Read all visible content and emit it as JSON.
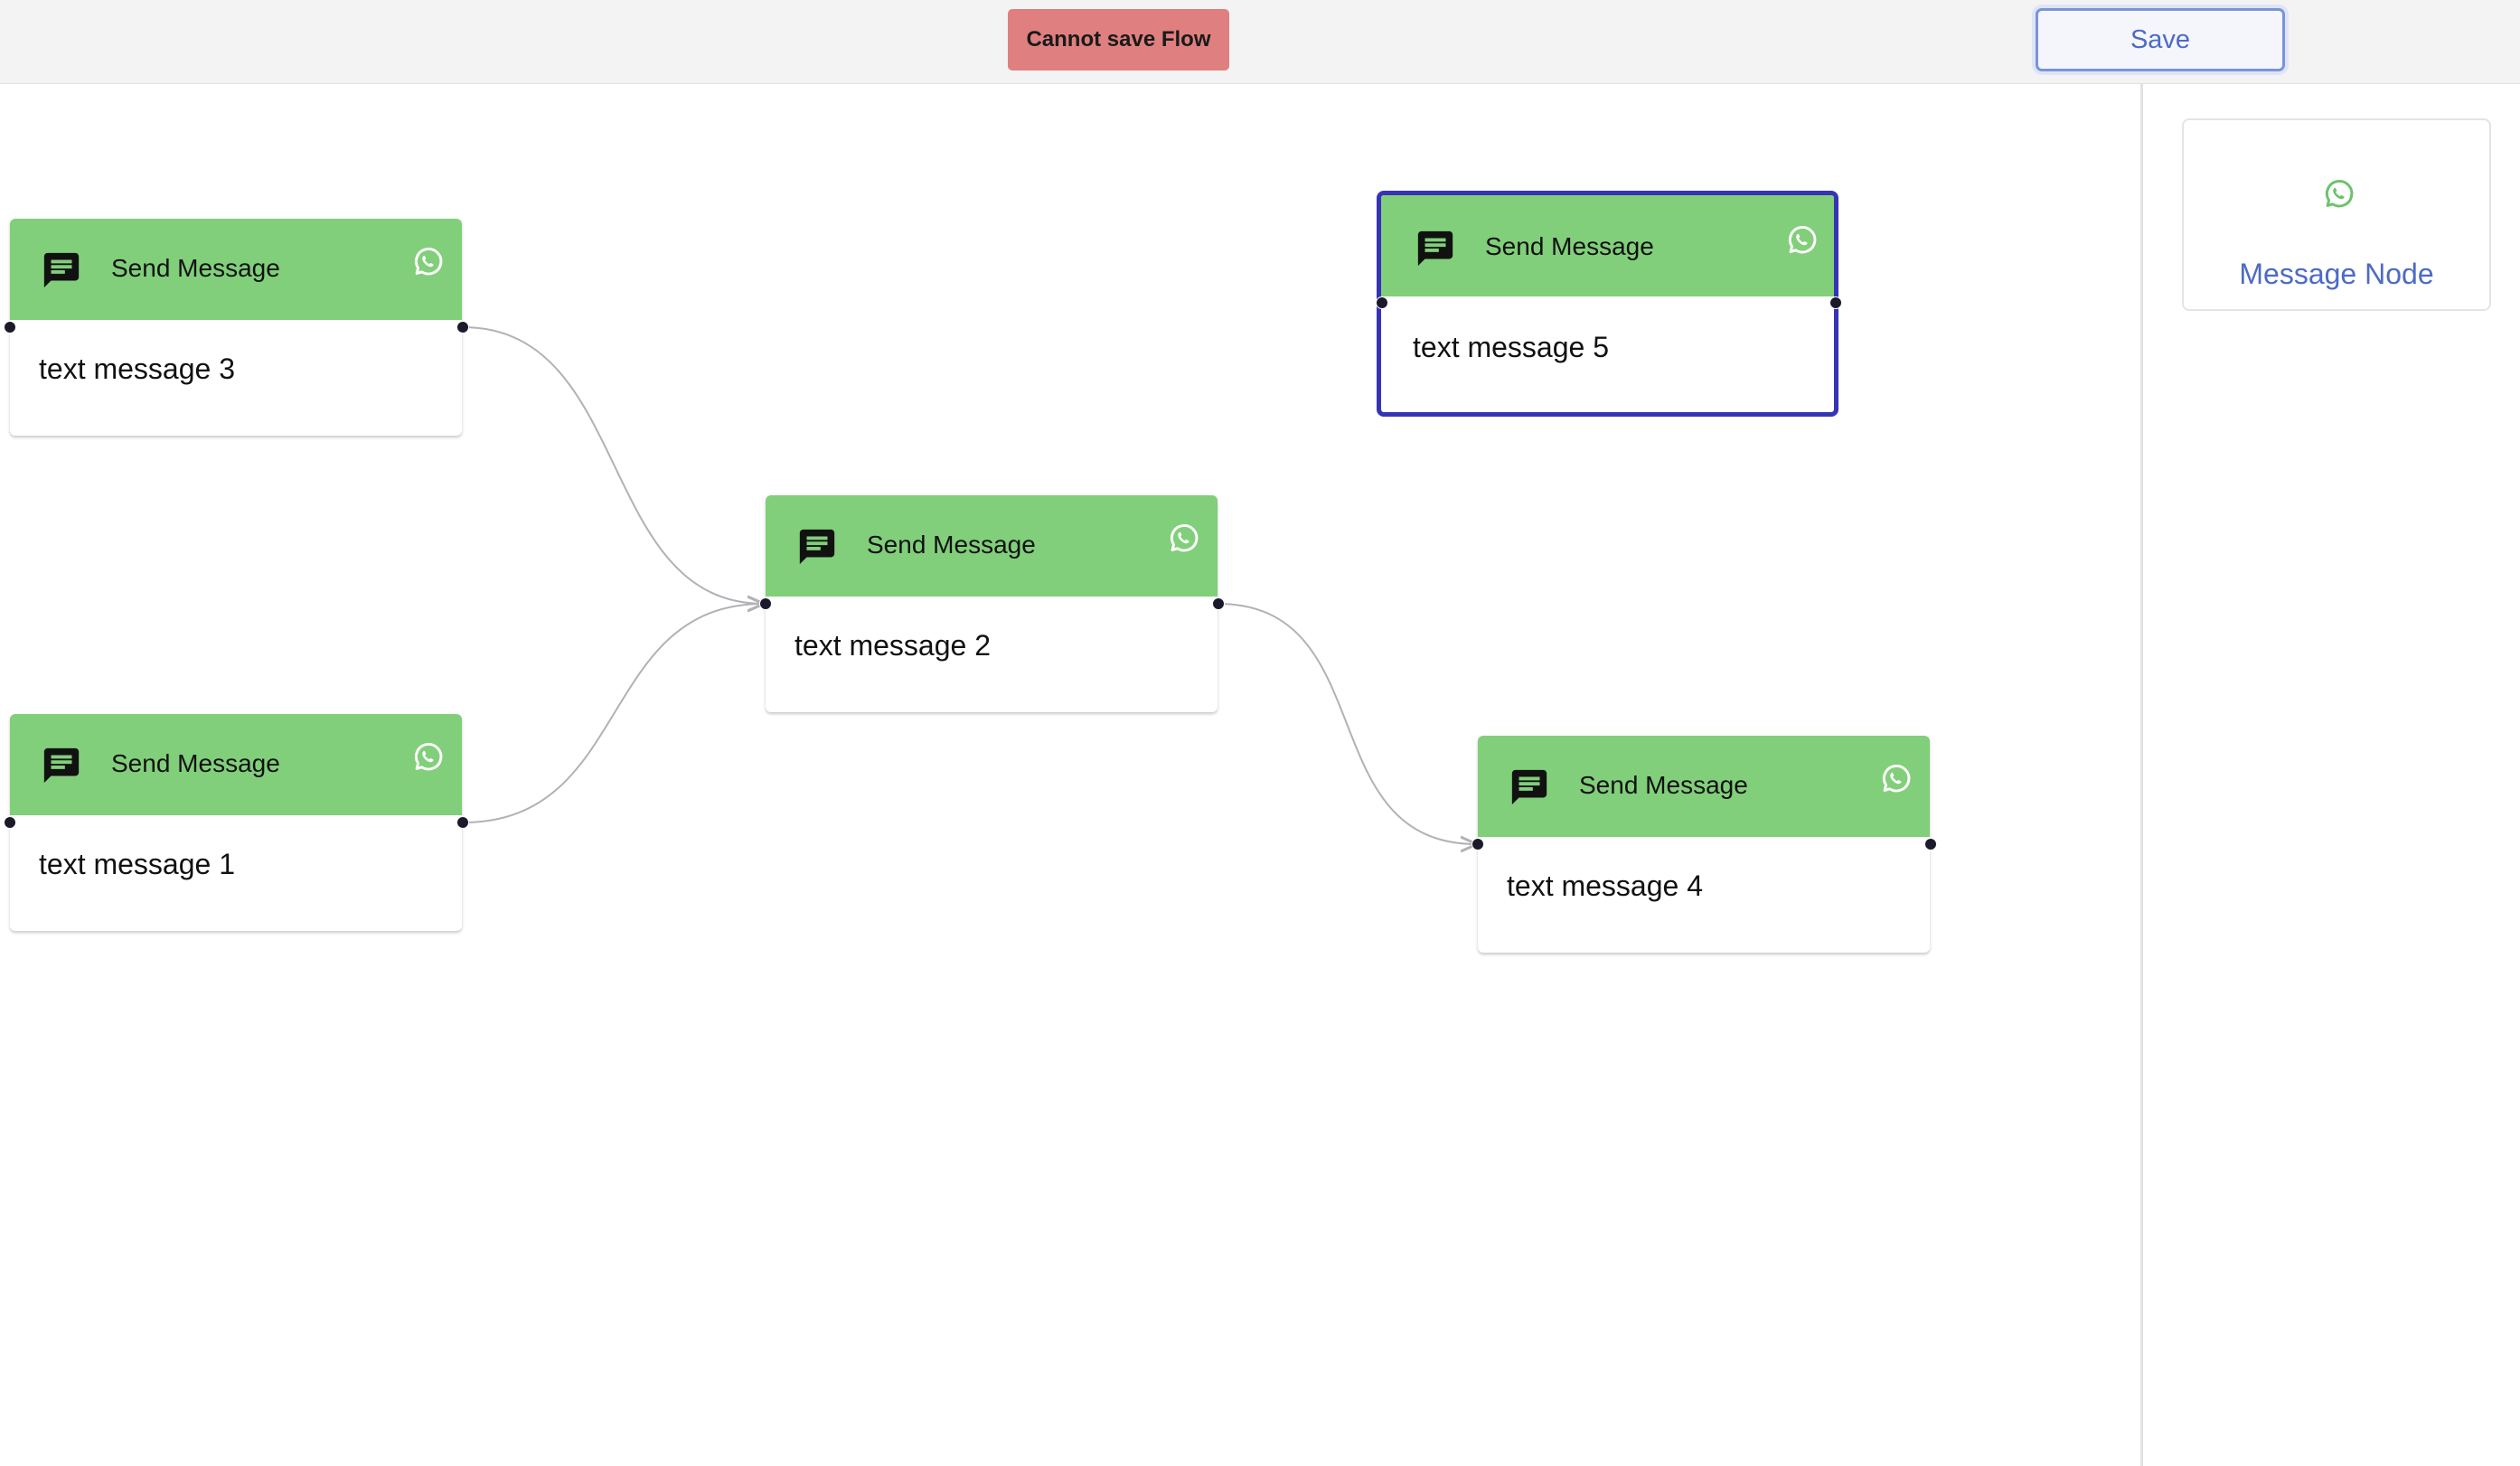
{
  "toolbar": {
    "error_message": "Cannot save Flow",
    "save_label": "Save"
  },
  "nodes": [
    {
      "id": "node-3",
      "title": "Send Message",
      "text": "text message 3",
      "selected": false
    },
    {
      "id": "node-1",
      "title": "Send Message",
      "text": "text message 1",
      "selected": false
    },
    {
      "id": "node-2",
      "title": "Send Message",
      "text": "text message 2",
      "selected": false
    },
    {
      "id": "node-5",
      "title": "Send Message",
      "text": "text message 5",
      "selected": true
    },
    {
      "id": "node-4",
      "title": "Send Message",
      "text": "text message 4",
      "selected": false
    }
  ],
  "edges": [
    {
      "source": "node-3",
      "target": "node-2"
    },
    {
      "source": "node-1",
      "target": "node-2"
    },
    {
      "source": "node-2",
      "target": "node-4"
    }
  ],
  "sidepanel": {
    "items": [
      {
        "label": "Message Node",
        "icon": "whatsapp-icon"
      }
    ]
  },
  "colors": {
    "node_header": "#81cf7a",
    "selected_border": "#3634b4",
    "error_banner": "#e07f7f",
    "accent_text": "#4d6ac6"
  },
  "icons": {
    "node_header_left": "message-icon",
    "node_header_right": "whatsapp-icon"
  }
}
